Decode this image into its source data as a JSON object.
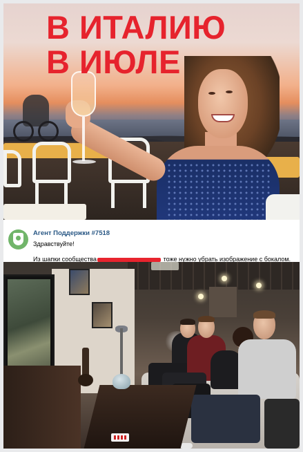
{
  "banner": {
    "headline_line1": "В ИТАЛИЮ",
    "headline_line2": "В ИЮЛЕ",
    "headline_color": "#e6232d"
  },
  "message": {
    "sender": "Агент Поддержки #7518",
    "greeting": "Здравствуйте!",
    "body_before": "Из шапки сообщества",
    "body_after": "тоже нужно убрать изображение с бокалом.",
    "redaction_color": "#e8242e",
    "sender_color": "#2a5885",
    "avatar_icon": "support-shield-icon",
    "avatar_color": "#71b56a"
  }
}
